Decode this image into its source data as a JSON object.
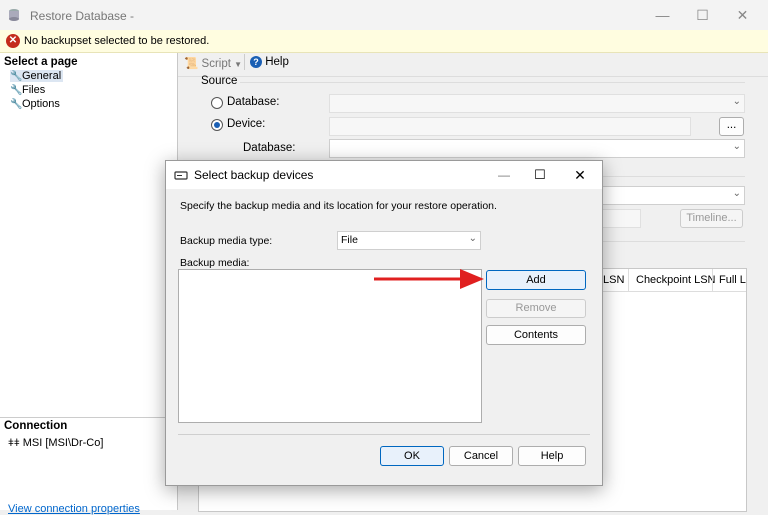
{
  "window": {
    "title": "Restore Database -"
  },
  "message_bar": {
    "text": "No backupset selected to be restored."
  },
  "left_pane": {
    "select_page_heading": "Select a page",
    "pages": [
      {
        "label": "General"
      },
      {
        "label": "Files"
      },
      {
        "label": "Options"
      }
    ],
    "connection_heading": "Connection",
    "connection_value": "MSI [MSI\\Dr-Co]",
    "connection_link": "View connection properties"
  },
  "toolbar": {
    "script_label": "Script",
    "help_label": "Help"
  },
  "source": {
    "heading": "Source",
    "database_radio": "Database:",
    "device_radio": "Device:",
    "database_label": "Database:",
    "browse_button": "...",
    "timeline_button": "Timeline..."
  },
  "grid_headers": [
    "LSN",
    "Checkpoint LSN",
    "Full LS"
  ],
  "dialog": {
    "title": "Select backup devices",
    "description": "Specify the backup media and its location for your restore operation.",
    "media_type_label": "Backup media type:",
    "media_type_value": "File",
    "media_label": "Backup media:",
    "add_button": "Add",
    "remove_button": "Remove",
    "contents_button": "Contents",
    "ok_button": "OK",
    "cancel_button": "Cancel",
    "help_button": "Help"
  },
  "colors": {
    "arrow": "#e02020",
    "error": "#c42b1c",
    "message_bg": "#fffde0"
  }
}
